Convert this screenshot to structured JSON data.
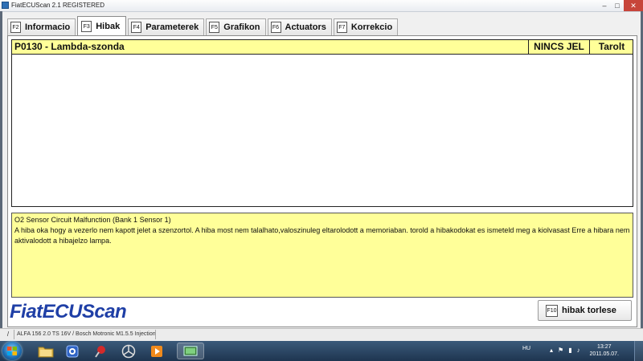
{
  "window": {
    "title": "FiatECUScan 2.1 REGISTERED",
    "buttons": {
      "minimize": "–",
      "maximize": "□",
      "close": "✕"
    }
  },
  "tabs": [
    {
      "key": "F2",
      "label": "Informacio",
      "active": false
    },
    {
      "key": "F3",
      "label": "Hibak",
      "active": true
    },
    {
      "key": "F4",
      "label": "Parameterek",
      "active": false
    },
    {
      "key": "F5",
      "label": "Grafikon",
      "active": false
    },
    {
      "key": "F6",
      "label": "Actuators",
      "active": false
    },
    {
      "key": "F7",
      "label": "Korrekcio",
      "active": false
    }
  ],
  "faults": [
    {
      "code": "P0130 - Lambda-szonda",
      "status": "NINCS JEL",
      "state": "Tarolt"
    }
  ],
  "description": {
    "title": "O2 Sensor Circuit Malfunction (Bank 1 Sensor 1)",
    "body": "A hiba oka hogy a vezerlo nem kapott jelet a szenzortol. A hiba most nem talalhato,valoszinuleg eltarolodott a memoriaban. torold a hibakodokat es ismeteld meg a kiolvasast Erre a hibara nem aktivalodott a hibajelzo lampa."
  },
  "brand": "FiatECUScan",
  "actions": {
    "clear_key": "F10",
    "clear_label": "hibak torlese"
  },
  "statusbar": {
    "indicator": "/",
    "vehicle": "ALFA 156 2.0 TS 16V / Bosch Motronic M1.5.5 Injection"
  },
  "taskbar": {
    "items": [
      "folder-icon",
      "vlc-icon",
      "pushpin-icon",
      "mercedes-icon",
      "media-player-icon",
      "fiatecuscan-icon"
    ],
    "language": "HU",
    "time": "13:27",
    "date": "2011.05.07."
  },
  "colors": {
    "highlight_yellow": "#ffff99",
    "brand_blue": "#1f3fa6",
    "taskbar": "#1e3550",
    "close_button": "#c7453a"
  }
}
